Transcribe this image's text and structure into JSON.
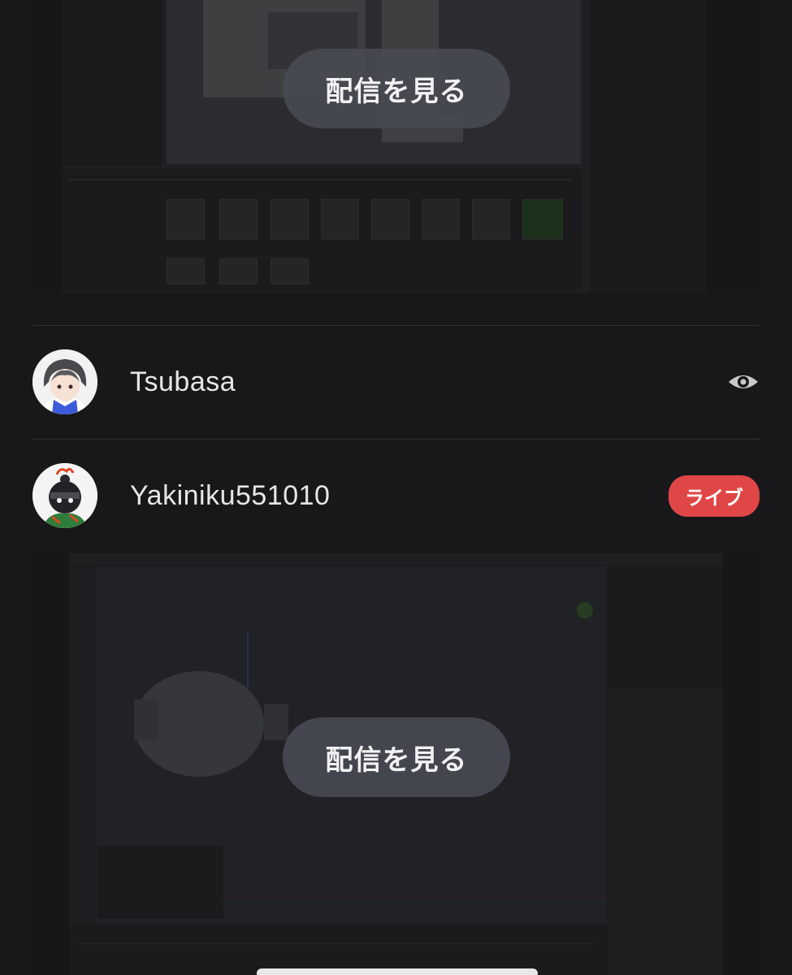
{
  "streams": [
    {
      "watch_label": "配信を見る"
    },
    {
      "watch_label": "配信を見る"
    }
  ],
  "users": [
    {
      "name": "Tsubasa",
      "status_icon": "eye-icon"
    },
    {
      "name": "Yakiniku551010",
      "badge": "ライブ",
      "badge_color": "#e04646"
    }
  ]
}
